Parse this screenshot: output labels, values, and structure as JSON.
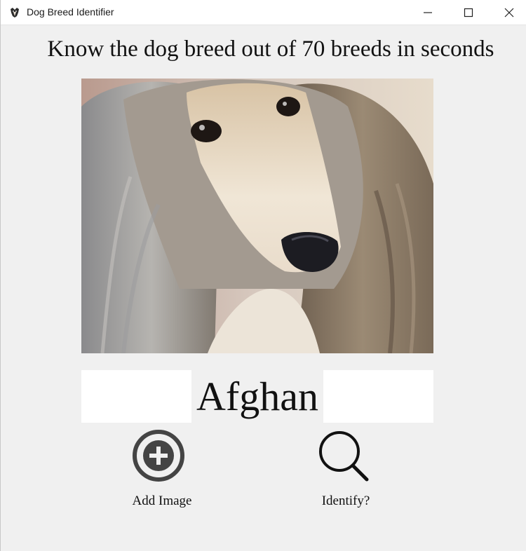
{
  "window": {
    "title": "Dog Breed Identifier",
    "controls": [
      "minimize",
      "maximize",
      "close"
    ]
  },
  "main": {
    "headline": "Know the dog breed out of 70 breeds in seconds",
    "image": {
      "icon": "dog-photo-afghan-hound"
    },
    "result": "Afghan",
    "actions": [
      {
        "label": "Add Image",
        "icon": "add-circle-icon"
      },
      {
        "label": "Identify?",
        "icon": "search-icon"
      }
    ]
  },
  "colors": {
    "background": "#f0f0f0",
    "icon_dark": "#444444",
    "text": "#111111"
  }
}
